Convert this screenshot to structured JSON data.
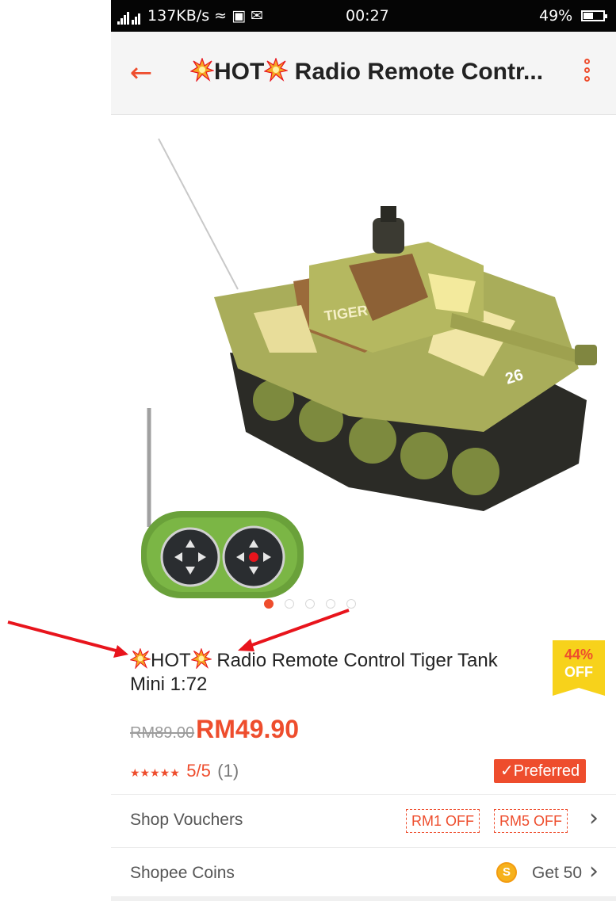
{
  "status_bar": {
    "network_speed": "137KB/s",
    "time": "00:27",
    "battery": "49%",
    "battery_level": 0.49
  },
  "app_bar": {
    "title": "HOT Radio Remote Contr..."
  },
  "product": {
    "title": "HOT Radio Remote Control Tiger Tank Mini 1:72",
    "title_hot": "HOT",
    "title_rest": " Radio Remote Control Tiger Tank Mini 1:72",
    "discount_percent": "44%",
    "discount_label": "OFF",
    "original_price": "RM89.00",
    "current_price": "RM49.90",
    "rating_stars": "★★★★★",
    "rating_score": "5/5",
    "rating_count": "(1)",
    "preferred_label": "✓Preferred",
    "image_count": 5,
    "active_image": 1
  },
  "shop_vouchers": {
    "label": "Shop Vouchers",
    "vouchers": [
      "RM1 OFF",
      "RM5 OFF"
    ]
  },
  "shopee_coins": {
    "label": "Shopee Coins",
    "value": "Get 50",
    "icon_letter": "S"
  },
  "colors": {
    "accent": "#ee4d2d",
    "badge_yellow": "#f7d21b",
    "annotation_red": "#e8141c"
  }
}
